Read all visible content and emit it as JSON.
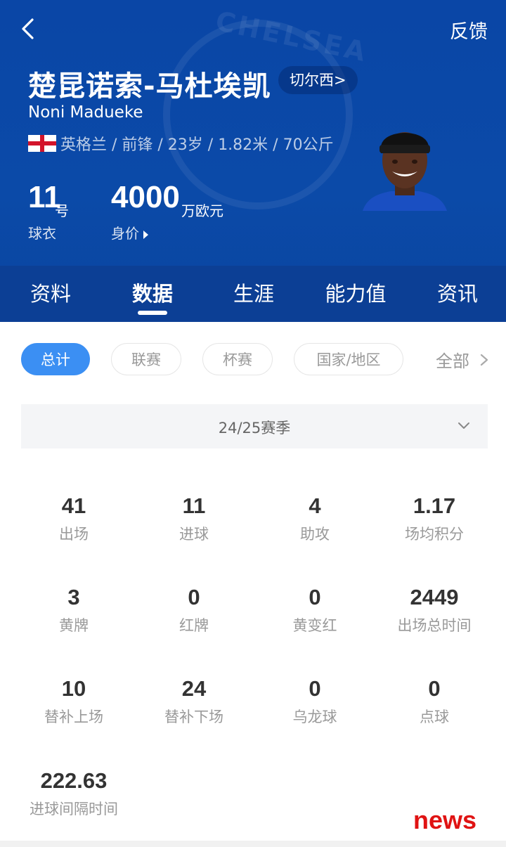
{
  "header": {
    "back_icon": "chevron-left-icon",
    "feedback": "反馈",
    "name_zh": "楚昆诺索-马杜埃凯",
    "club_link": "切尔西>",
    "name_en": "Noni Madueke",
    "flag": "england-flag",
    "info": "英格兰 / 前锋 / 23岁 / 1.82米 / 70公斤",
    "shirt_number": "11",
    "shirt_unit": "号",
    "shirt_label": "球衣",
    "value": "4000",
    "value_unit": "万欧元",
    "value_label": "身价",
    "crest_watermark": "CHELSEA",
    "bg_color": "#0b4aa8"
  },
  "tabs": [
    {
      "label": "资料",
      "active": false
    },
    {
      "label": "数据",
      "active": true
    },
    {
      "label": "生涯",
      "active": false
    },
    {
      "label": "能力值",
      "active": false
    },
    {
      "label": "资讯",
      "active": false
    }
  ],
  "filters": [
    {
      "label": "总计",
      "active": true
    },
    {
      "label": "联赛",
      "active": false
    },
    {
      "label": "杯赛",
      "active": false
    },
    {
      "label": "国家/地区",
      "active": false
    }
  ],
  "filter_all": "全部",
  "season": "24/25赛季",
  "stats": [
    {
      "value": "41",
      "label": "出场"
    },
    {
      "value": "11",
      "label": "进球"
    },
    {
      "value": "4",
      "label": "助攻"
    },
    {
      "value": "1.17",
      "label": "场均积分"
    },
    {
      "value": "3",
      "label": "黄牌"
    },
    {
      "value": "0",
      "label": "红牌"
    },
    {
      "value": "0",
      "label": "黄变红"
    },
    {
      "value": "2449",
      "label": "出场总时间"
    },
    {
      "value": "10",
      "label": "替补上场"
    },
    {
      "value": "24",
      "label": "替补下场"
    },
    {
      "value": "0",
      "label": "乌龙球"
    },
    {
      "value": "0",
      "label": "点球"
    },
    {
      "value": "222.63",
      "label": "进球间隔时间"
    }
  ],
  "watermark": "news",
  "accent_color": "#3b8ff3"
}
